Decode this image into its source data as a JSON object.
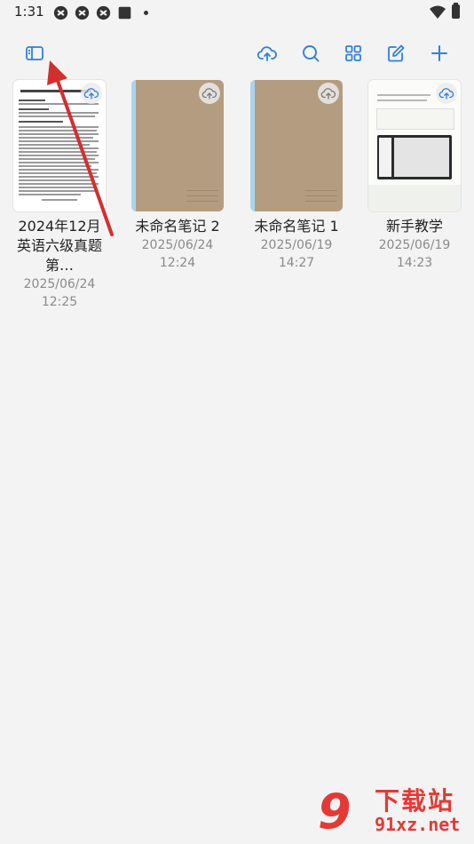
{
  "status_bar": {
    "time": "1:31",
    "icons": [
      "app-icon",
      "app-icon",
      "app-icon",
      "gallery-icon"
    ],
    "right_icons": [
      "wifi-icon",
      "battery-icon"
    ]
  },
  "toolbar": {
    "left": "sidebar-toggle-icon",
    "right": [
      "cloud-upload-icon",
      "search-icon",
      "grid-view-icon",
      "edit-icon",
      "add-icon"
    ],
    "accent_color": "#2f7fe0"
  },
  "notes": [
    {
      "title": "2024年12月英语六级真题第…",
      "date": "2025/06/24",
      "time": "12:25",
      "cover": "document"
    },
    {
      "title": "未命名笔记 2",
      "date": "2025/06/24",
      "time": "12:24",
      "cover": "kraft"
    },
    {
      "title": "未命名笔记 1",
      "date": "2025/06/19",
      "time": "14:27",
      "cover": "kraft"
    },
    {
      "title": "新手教学",
      "date": "2025/06/19",
      "time": "14:23",
      "cover": "tutorial"
    }
  ],
  "watermark": {
    "logo": "9",
    "title": "下载站",
    "url": "91xz.net"
  },
  "annotation_color": "#d32f2f"
}
